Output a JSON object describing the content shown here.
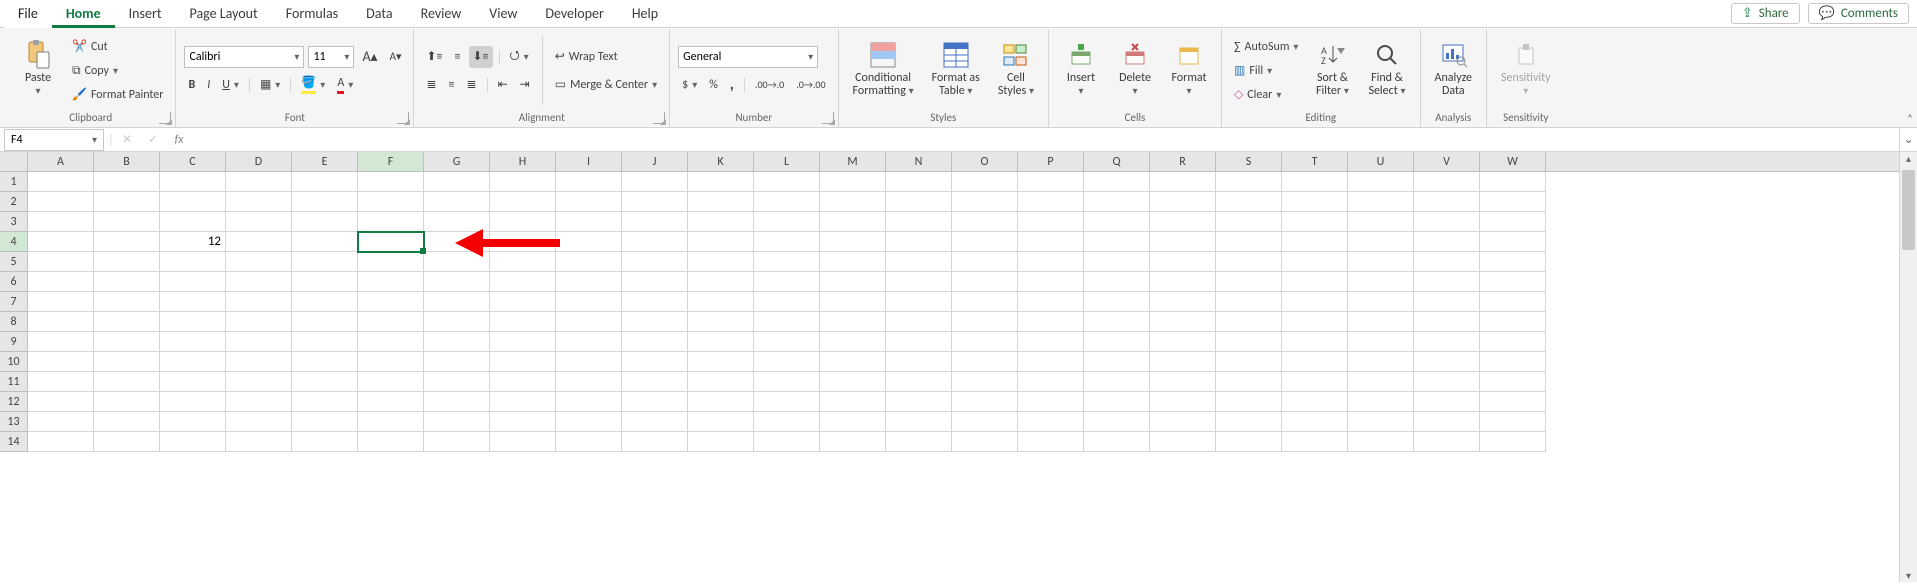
{
  "tabs": {
    "file": "File",
    "items": [
      "Home",
      "Insert",
      "Page Layout",
      "Formulas",
      "Data",
      "Review",
      "View",
      "Developer",
      "Help"
    ],
    "active": "Home",
    "share": "Share",
    "comments": "Comments"
  },
  "ribbon": {
    "clipboard": {
      "label": "Clipboard",
      "paste": "Paste",
      "cut": "Cut",
      "copy": "Copy",
      "format_painter": "Format Painter"
    },
    "font": {
      "label": "Font",
      "name": "Calibri",
      "size": "11",
      "bold": "B",
      "italic": "I",
      "underline": "U"
    },
    "alignment": {
      "label": "Alignment",
      "wrap": "Wrap Text",
      "merge": "Merge & Center"
    },
    "number": {
      "label": "Number",
      "format": "General"
    },
    "styles": {
      "label": "Styles",
      "cond": "Conditional",
      "cond2": "Formatting",
      "fat": "Format as",
      "fat2": "Table",
      "cell": "Cell",
      "cell2": "Styles"
    },
    "cells": {
      "label": "Cells",
      "insert": "Insert",
      "delete": "Delete",
      "format": "Format"
    },
    "editing": {
      "label": "Editing",
      "autosum": "AutoSum",
      "fill": "Fill",
      "clear": "Clear",
      "sort": "Sort &",
      "sort2": "Filter",
      "find": "Find &",
      "find2": "Select"
    },
    "analysis": {
      "label": "Analysis",
      "analyze": "Analyze",
      "analyze2": "Data"
    },
    "sensitivity": {
      "label": "Sensitivity",
      "btn": "Sensitivity"
    }
  },
  "fbar": {
    "name": "F4",
    "fx": "fx",
    "formula": ""
  },
  "grid": {
    "cols": [
      "A",
      "B",
      "C",
      "D",
      "E",
      "F",
      "G",
      "H",
      "I",
      "J",
      "K",
      "L",
      "M",
      "N",
      "O",
      "P",
      "Q",
      "R",
      "S",
      "T",
      "U",
      "V",
      "W"
    ],
    "rows": [
      1,
      2,
      3,
      4,
      5,
      6,
      7,
      8,
      9,
      10,
      11,
      12,
      13,
      14
    ],
    "selected": {
      "col": "F",
      "row": 4
    },
    "cells": {
      "C4": "12"
    }
  }
}
